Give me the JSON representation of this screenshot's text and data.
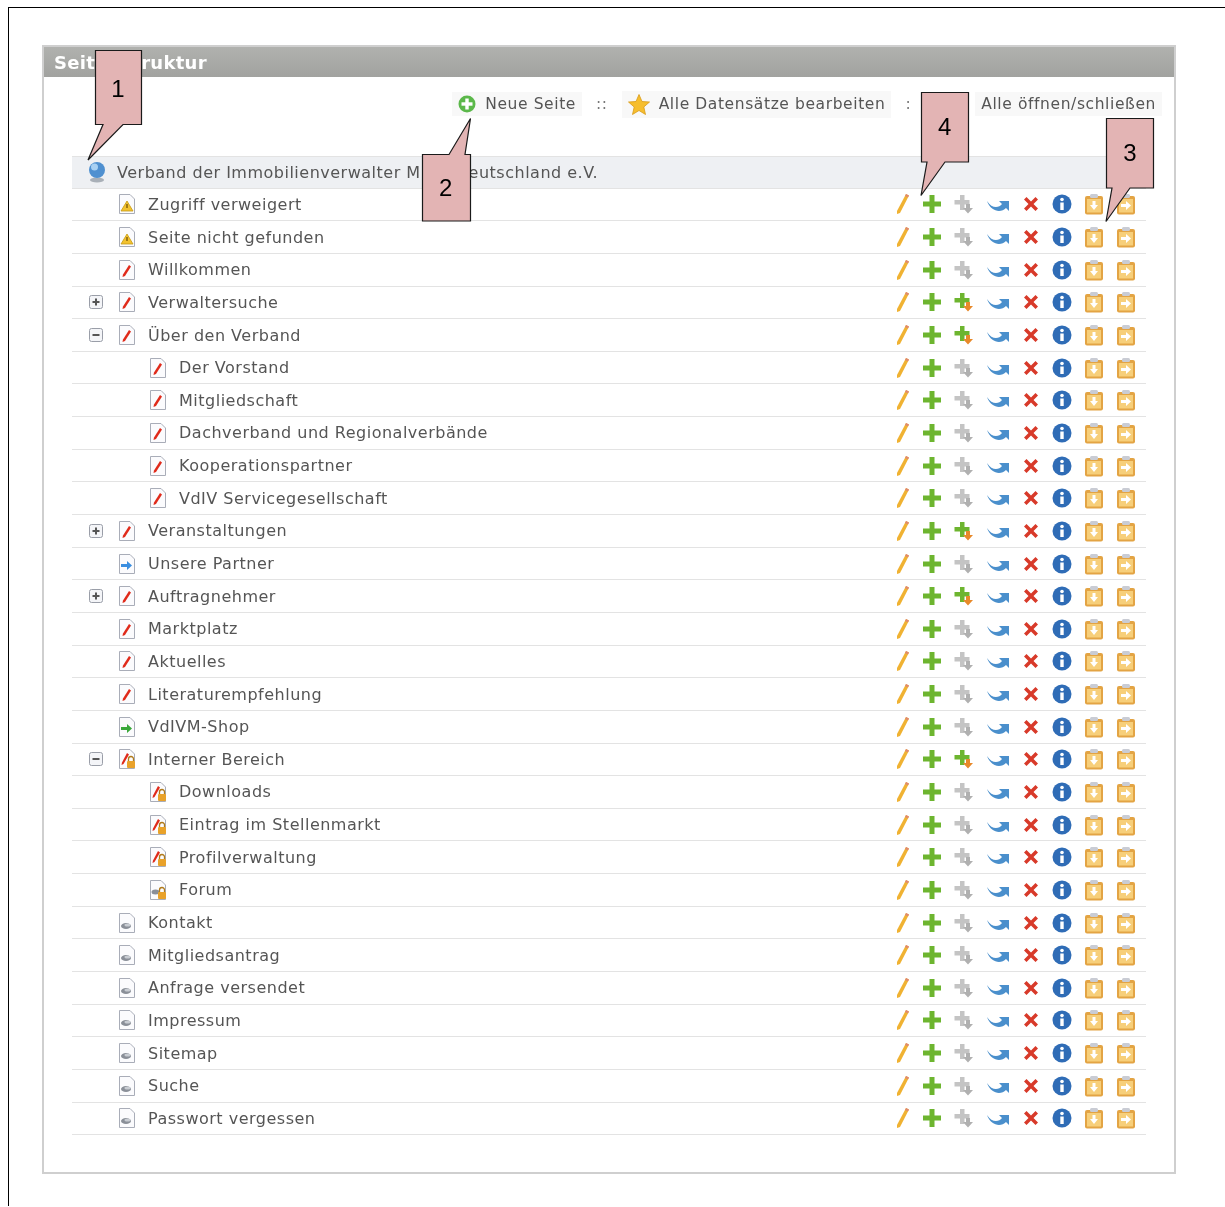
{
  "panel": {
    "title_parts": [
      "Seit",
      "ruktur"
    ]
  },
  "toolbar": [
    {
      "kind": "new",
      "label": "Neue Seite"
    },
    {
      "kind": "separator",
      "label": "::"
    },
    {
      "kind": "edit_all",
      "label": "Alle Datensätze bearbeiten"
    },
    {
      "kind": "separator",
      "label": ":"
    },
    {
      "kind": "toggle_all",
      "label": "Alle öffnen/schließen"
    }
  ],
  "tree": {
    "root": {
      "label_parts": [
        "Verband der Immobilienverwalter M",
        "eutschland e.V."
      ],
      "kind": "globe",
      "children": [
        {
          "label": "Zugriff verweigert",
          "kind": "warning",
          "subpage_action": false
        },
        {
          "label": "Seite nicht gefunden",
          "kind": "warning",
          "subpage_action": false
        },
        {
          "label": "Willkommen",
          "kind": "edit",
          "subpage_action": false
        },
        {
          "label": "Verwaltersuche",
          "kind": "edit",
          "expanded": false,
          "subpage_action": true
        },
        {
          "label": "Über den Verband",
          "kind": "edit",
          "expanded": true,
          "subpage_action": true,
          "children": [
            {
              "label": "Der Vorstand",
              "kind": "edit",
              "subpage_action": false
            },
            {
              "label": "Mitgliedschaft",
              "kind": "edit",
              "subpage_action": false
            },
            {
              "label": "Dachverband und Regionalverbände",
              "kind": "edit",
              "subpage_action": false
            },
            {
              "label": "Kooperationspartner",
              "kind": "edit",
              "subpage_action": false
            },
            {
              "label": "VdIV Servicegesellschaft",
              "kind": "edit",
              "subpage_action": false
            }
          ]
        },
        {
          "label": "Veranstaltungen",
          "kind": "edit",
          "expanded": false,
          "subpage_action": true
        },
        {
          "label": "Unsere Partner",
          "kind": "shortcut",
          "subpage_action": false
        },
        {
          "label": "Auftragnehmer",
          "kind": "edit",
          "expanded": false,
          "subpage_action": true
        },
        {
          "label": "Marktplatz",
          "kind": "edit",
          "subpage_action": false
        },
        {
          "label": "Aktuelles",
          "kind": "edit",
          "subpage_action": false
        },
        {
          "label": "Literaturempfehlung",
          "kind": "edit",
          "subpage_action": false
        },
        {
          "label": "VdIVM-Shop",
          "kind": "external",
          "subpage_action": false
        },
        {
          "label": "Interner Bereich",
          "kind": "locked",
          "expanded": true,
          "subpage_action": true,
          "children": [
            {
              "label": "Downloads",
              "kind": "locked",
              "subpage_action": false
            },
            {
              "label": "Eintrag im Stellenmarkt",
              "kind": "locked",
              "subpage_action": false
            },
            {
              "label": "Profilverwaltung",
              "kind": "locked",
              "subpage_action": false
            },
            {
              "label": "Forum",
              "kind": "locked_module",
              "subpage_action": false
            }
          ]
        },
        {
          "label": "Kontakt",
          "kind": "module",
          "subpage_action": false
        },
        {
          "label": "Mitgliedsantrag",
          "kind": "module",
          "subpage_action": false
        },
        {
          "label": "Anfrage versendet",
          "kind": "module",
          "subpage_action": false
        },
        {
          "label": "Impressum",
          "kind": "module",
          "subpage_action": false
        },
        {
          "label": "Sitemap",
          "kind": "module",
          "subpage_action": false
        },
        {
          "label": "Suche",
          "kind": "module",
          "subpage_action": false
        },
        {
          "label": "Passwort vergessen",
          "kind": "module",
          "subpage_action": false
        }
      ]
    }
  },
  "callouts": [
    {
      "number": "1"
    },
    {
      "number": "2"
    },
    {
      "number": "3"
    },
    {
      "number": "4"
    }
  ]
}
